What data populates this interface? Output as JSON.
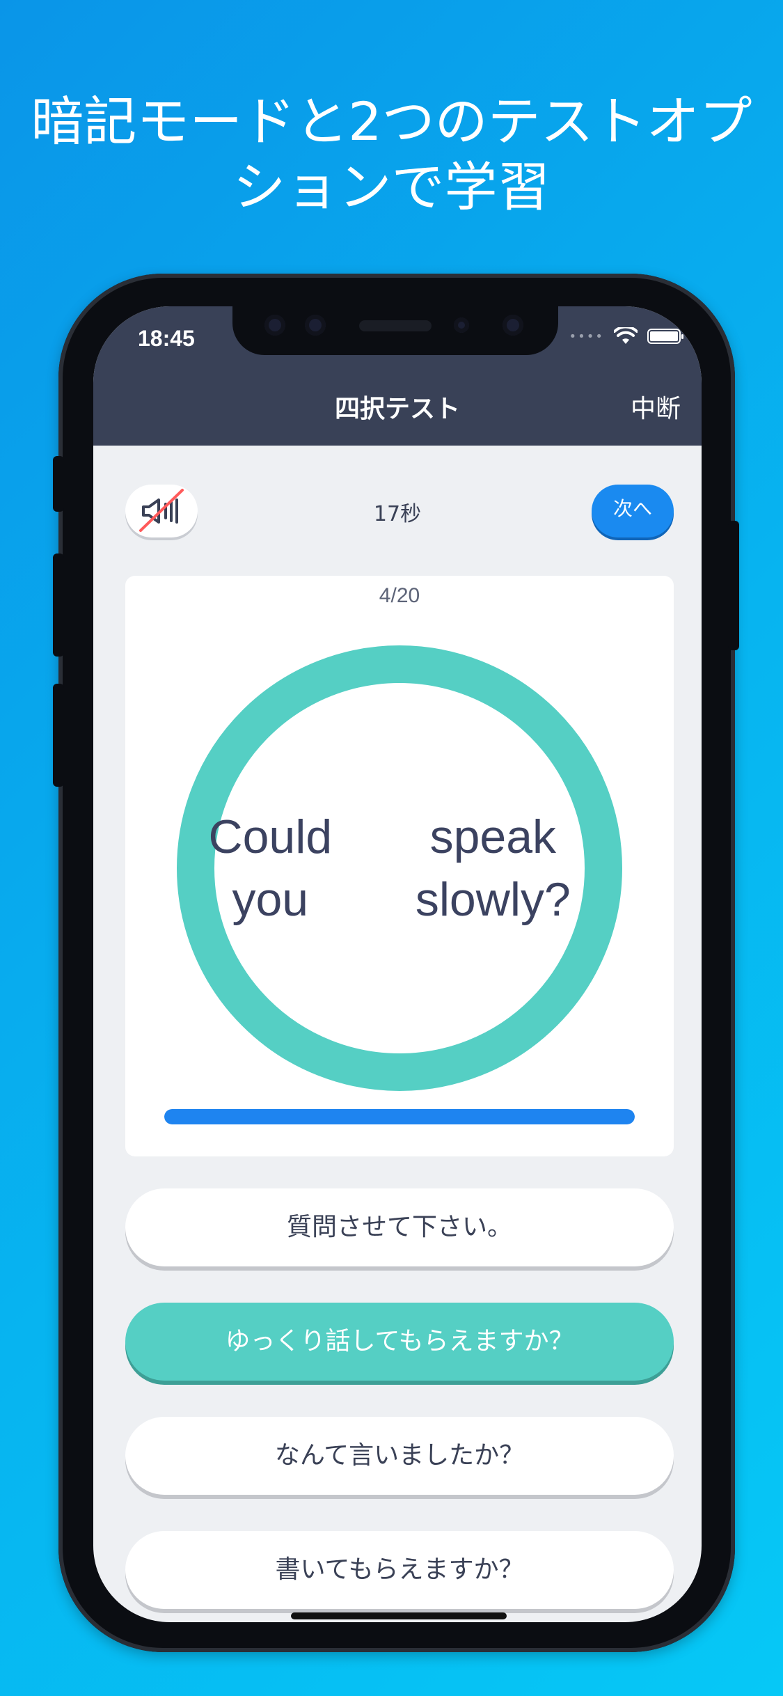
{
  "headline": {
    "line1": "暗記モードと2つのテストオプ",
    "line2": "ションで学習"
  },
  "status_bar": {
    "time": "18:45",
    "signal_dots": "••••"
  },
  "navbar": {
    "title": "四択テスト",
    "action_label": "中断"
  },
  "controls": {
    "timer_text": "17秒",
    "next_label": "次へ"
  },
  "card": {
    "progress_label": "4/20",
    "question": "Could you speak slowly?",
    "time_remaining_fraction": 1.0
  },
  "choices": [
    {
      "label": "質問させて下さい。",
      "selected": false
    },
    {
      "label": "ゆっくり話してもらえますか？",
      "selected": true
    },
    {
      "label": "なんて言いましたか？",
      "selected": false
    },
    {
      "label": "書いてもらえますか？",
      "selected": false
    }
  ],
  "colors": {
    "accent_teal": "#55cfc4",
    "accent_blue": "#1a8af0",
    "navbar": "#394157",
    "background_gradient_start": "#0a95e8",
    "background_gradient_end": "#06c8f6"
  },
  "icons": {
    "mute": "speaker-muted-icon",
    "wifi": "wifi-icon",
    "battery": "battery-icon"
  }
}
